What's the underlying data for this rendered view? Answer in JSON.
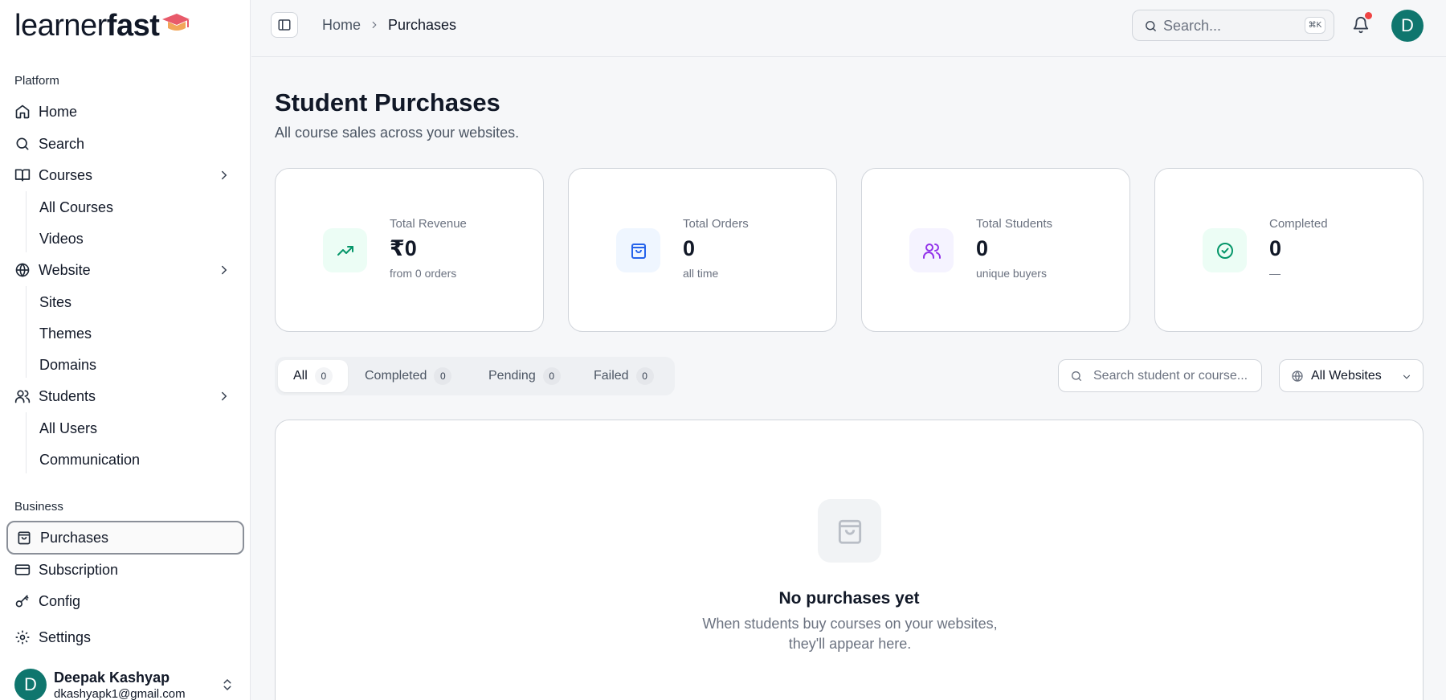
{
  "brand": {
    "name_light": "learner",
    "name_bold": "fast",
    "cap_color": "#e85a6a",
    "cap_accent": "#f2a65a"
  },
  "sidebar": {
    "groups": {
      "platform": "Platform",
      "business": "Business"
    },
    "items": {
      "home": "Home",
      "search": "Search",
      "courses": "Courses",
      "all_courses": "All Courses",
      "videos": "Videos",
      "website": "Website",
      "sites": "Sites",
      "themes": "Themes",
      "domains": "Domains",
      "students": "Students",
      "all_users": "All Users",
      "communication": "Communication",
      "purchases": "Purchases",
      "subscription": "Subscription",
      "config": "Config",
      "settings": "Settings"
    },
    "active_item": "purchases",
    "user": {
      "initial": "D",
      "name": "Deepak Kashyap",
      "email": "dkashyapk1@gmail.com"
    }
  },
  "header": {
    "breadcrumb": {
      "home": "Home",
      "current": "Purchases"
    },
    "search_placeholder": "Search...",
    "shortcut": "⌘K",
    "avatar_initial": "D",
    "has_notification": true
  },
  "page": {
    "title": "Student Purchases",
    "subtitle": "All course sales across your websites."
  },
  "stats": [
    {
      "label": "Total Revenue",
      "value": "₹0",
      "note": "from 0 orders",
      "icon": "trending-up-icon",
      "icon_color": "#059669",
      "icon_bg": "#ecfdf5"
    },
    {
      "label": "Total Orders",
      "value": "0",
      "note": "all time",
      "icon": "shopping-bag-icon",
      "icon_color": "#2563eb",
      "icon_bg": "#eff6ff"
    },
    {
      "label": "Total Students",
      "value": "0",
      "note": "unique buyers",
      "icon": "users-icon",
      "icon_color": "#9333ea",
      "icon_bg": "#f5f3ff"
    },
    {
      "label": "Completed",
      "value": "0",
      "note": "—",
      "icon": "check-circle-icon",
      "icon_color": "#059669",
      "icon_bg": "#ecfdf5"
    }
  ],
  "filters": {
    "tabs": [
      {
        "label": "All",
        "count": "0"
      },
      {
        "label": "Completed",
        "count": "0"
      },
      {
        "label": "Pending",
        "count": "0"
      },
      {
        "label": "Failed",
        "count": "0"
      }
    ],
    "active_tab": "All",
    "search_placeholder": "Search student or course...",
    "website_select": "All Websites"
  },
  "empty_state": {
    "title": "No purchases yet",
    "line1": "When students buy courses on your websites,",
    "line2": "they'll appear here."
  }
}
